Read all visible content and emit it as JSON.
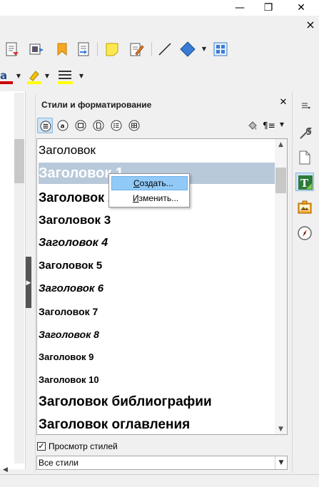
{
  "window": {
    "minimize_glyph": "—",
    "restore_glyph": "❐",
    "close_glyph": "✕",
    "doc_close_glyph": "×"
  },
  "sidebar": {
    "title": "Стили и форматирование",
    "close_glyph": "✕",
    "toolbar_icons": [
      "paragraph-styles-icon",
      "character-styles-icon",
      "frame-styles-icon",
      "page-styles-icon",
      "list-styles-icon",
      "table-styles-icon"
    ],
    "fill_format_icon": "fill-format-mode-icon",
    "style_actions_icon": "new-style-menu-icon",
    "style_actions_glyph": "¶≡",
    "styles": [
      {
        "name": "Заголовок",
        "size": 17,
        "bold": false,
        "italic": false
      },
      {
        "name": "Заголовок 1",
        "size": 20,
        "bold": true,
        "italic": false,
        "selected": true
      },
      {
        "name": "Заголовок 2",
        "size": 18,
        "bold": true,
        "italic": false
      },
      {
        "name": "Заголовок 3",
        "size": 17,
        "bold": true,
        "italic": false
      },
      {
        "name": "Заголовок 4",
        "size": 16,
        "bold": true,
        "italic": true
      },
      {
        "name": "Заголовок 5",
        "size": 15,
        "bold": true,
        "italic": false
      },
      {
        "name": "Заголовок 6",
        "size": 15,
        "bold": true,
        "italic": true
      },
      {
        "name": "Заголовок 7",
        "size": 14,
        "bold": true,
        "italic": false
      },
      {
        "name": "Заголовок 8",
        "size": 14,
        "bold": true,
        "italic": true
      },
      {
        "name": "Заголовок 9",
        "size": 13,
        "bold": true,
        "italic": false
      },
      {
        "name": "Заголовок 10",
        "size": 13,
        "bold": true,
        "italic": false
      },
      {
        "name": "Заголовок библиографии",
        "size": 19,
        "bold": true,
        "italic": false
      },
      {
        "name": "Заголовок оглавления",
        "size": 19,
        "bold": true,
        "italic": false
      }
    ],
    "context_menu": {
      "items": [
        {
          "label": "Создать...",
          "hotkey_index": 0,
          "highlighted": true
        },
        {
          "label": "Изменить...",
          "hotkey_index": 0,
          "highlighted": false
        }
      ]
    },
    "preview_checkbox": {
      "label": "Просмотр стилей",
      "checked": true
    },
    "filter": {
      "value": "Все стили"
    }
  },
  "deck": {
    "buttons": [
      "menu-icon",
      "properties-icon",
      "page-icon",
      "styles-icon",
      "gallery-icon",
      "navigator-icon"
    ],
    "active": "styles-icon"
  },
  "colors": {
    "selection_bg": "#b8c9da",
    "menu_highlight": "#91c9f7",
    "active_tool": "#cde3f6",
    "font_color_bar": "#cc0000",
    "highlight_bar": "#ffff00"
  }
}
